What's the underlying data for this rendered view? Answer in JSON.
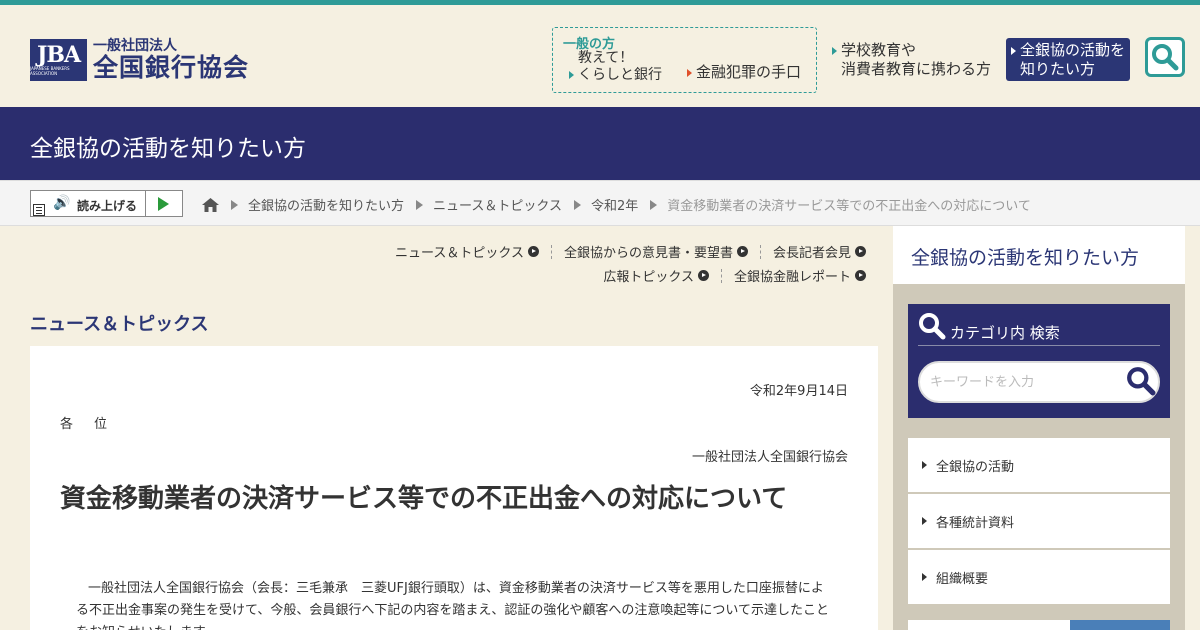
{
  "header": {
    "logo_abbr": "JBA",
    "logo_small": "JAPANESE BANKERS ASSOCIATION",
    "logo_sub": "一般社団法人",
    "logo_main": "全国銀行協会",
    "general_title": "一般の方",
    "general_item1_line1": "教えて！",
    "general_item1_line2": "くらしと銀行",
    "general_item2": "金融犯罪の手口",
    "school_line1": "学校教育や",
    "school_line2": "消費者教育に携わる方",
    "activity_line1": "全銀協の活動を",
    "activity_line2": "知りたい方"
  },
  "banner": {
    "title": "全銀協の活動を知りたい方"
  },
  "readspeaker": {
    "label": "読み上げる"
  },
  "breadcrumb": [
    "全銀協の活動を知りたい方",
    "ニュース＆トピックス",
    "令和2年",
    "資金移動業者の決済サービス等での不正出金への対応について"
  ],
  "subnav": {
    "row1": [
      "ニュース＆トピックス",
      "全銀協からの意見書・要望書",
      "会長記者会見"
    ],
    "row2": [
      "広報トピックス",
      "全銀協金融レポート"
    ]
  },
  "section_title": "ニュース＆トピックス",
  "article": {
    "date": "令和2年9月14日",
    "addressee": "各　位",
    "org": "一般社団法人全国銀行協会",
    "title": "資金移動業者の決済サービス等での不正出金への対応について",
    "body": "一般社団法人全国銀行協会（会長：三毛兼承　三菱UFJ銀行頭取）は、資金移動業者の決済サービス等を悪用した口座振替による不正出金事案の発生を受けて、今般、会員銀行へ下記の内容を踏まえ、認証の強化や顧客への注意喚起等について示達したことをお知らせいたします。"
  },
  "sidebar": {
    "title": "全銀協の活動を知りたい方",
    "search_title": "カテゴリ内 検索",
    "search_placeholder": "キーワードを入力",
    "menu": [
      "全銀協の活動",
      "各種統計資料",
      "組織概要"
    ]
  },
  "colors": {
    "navy": "#2b2d6e",
    "teal": "#2e9b97",
    "beige": "#f5f0e1"
  }
}
